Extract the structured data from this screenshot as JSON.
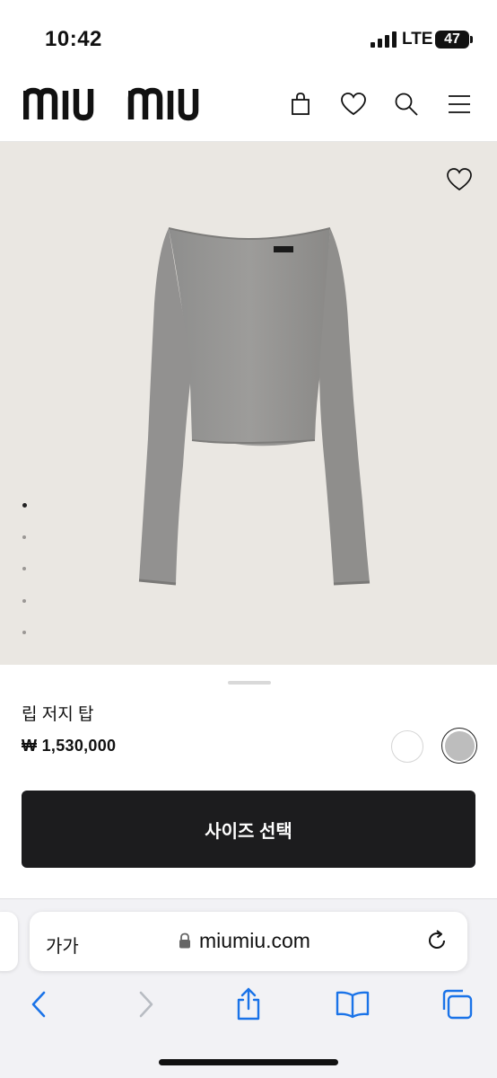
{
  "status_bar": {
    "time": "10:42",
    "network": "LTE",
    "battery": "47"
  },
  "header": {
    "logo_text": "miu miu",
    "icons": [
      "bag-icon",
      "heart-icon",
      "search-icon",
      "menu-icon"
    ]
  },
  "gallery": {
    "image_alt": "grey long-sleeve rib jersey top",
    "dot_count": 5,
    "active_index": 0
  },
  "product": {
    "name": "립 저지 탑",
    "price": "₩ 1,530,000",
    "colors": [
      {
        "name": "white",
        "hex": "#ffffff",
        "selected": false
      },
      {
        "name": "grey",
        "hex": "#bdbdbd",
        "selected": true
      }
    ],
    "cta_label": "사이즈 선택"
  },
  "browser": {
    "text_size_label": "가가",
    "domain": "miumiu.com",
    "toolbar": [
      "back-icon",
      "forward-icon",
      "share-icon",
      "bookmarks-icon",
      "tabs-icon"
    ]
  },
  "colors": {
    "cta_bg": "#1c1c1e",
    "hero_bg": "#eae7e2",
    "accent_blue": "#1a73e8"
  }
}
